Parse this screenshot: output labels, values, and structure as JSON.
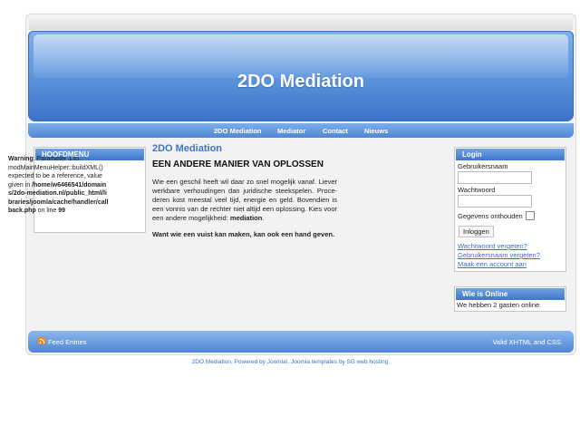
{
  "site": {
    "title": "2DO Mediation"
  },
  "nav": {
    "items": [
      {
        "label": "2DO Mediation"
      },
      {
        "label": "Mediator"
      },
      {
        "label": "Contact"
      },
      {
        "label": "Nieuws"
      }
    ]
  },
  "left_module": {
    "heading": "HOOFDMENU",
    "warning_label": "Warning",
    "warning_text_1": ": Parameter 1 to modMainMenuHelper::buildXML() expected to be a reference, value given in ",
    "warning_path": "/home/w6466541/domains/2do-mediation.nl/public_html/libraries/joomla/cache/handler/callback.php",
    "warning_text_2": " on line ",
    "warning_line": "99"
  },
  "article": {
    "title": "2DO Mediation",
    "heading": "EEN ANDERE MANIER VAN OPLOSSEN",
    "body_text": "Wie een geschil heeft wil daar zo snel mogelijk vanaf. Liever werkbare verhoudingen dan juridische steekspelen. Proce­deren kost meestal veel tijd, energie en geld. Bovendien is een vonnis van de rechter niet altijd een oplossing. Kies voor een andere mogelijkheid: ",
    "body_bold": "mediation",
    "body_end": ".",
    "tagline": "Want wie een vuist kan maken, kan ook een hand geven."
  },
  "login": {
    "heading": "Login",
    "username_label": "Gebruikersnaam",
    "username_value": "",
    "password_label": "Wachtwoord",
    "password_value": "",
    "remember_label": "Gegevens onthouden",
    "remember_checked": false,
    "submit_label": "Inloggen",
    "links": [
      {
        "label": "Wachtwoord vergeten?"
      },
      {
        "label": "Gebruikersnaam vergeten?"
      },
      {
        "label": "Maak een account aan"
      }
    ]
  },
  "online": {
    "heading": "Wie is Online",
    "text": "We hebben 2 gasten online"
  },
  "footer": {
    "feed_label": "Feed Entries",
    "valid_label": "Valid XHTML and CSS."
  },
  "credit": {
    "text": "2DO Mediation, Powered by Joomla!. Joomla templates by SG web hosting"
  },
  "colors": {
    "accent": "#3f74c7",
    "link": "#3a6fc4",
    "header_top": "#7fb0ea",
    "header_bottom": "#3c73c7"
  },
  "icons": {
    "feed": "rss-feed-icon"
  }
}
